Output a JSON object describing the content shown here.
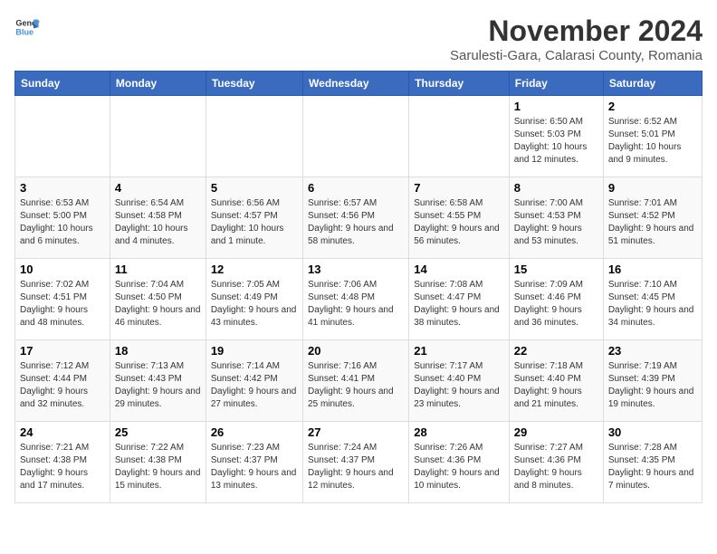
{
  "header": {
    "logo_line1": "General",
    "logo_line2": "Blue",
    "title": "November 2024",
    "subtitle": "Sarulesti-Gara, Calarasi County, Romania"
  },
  "calendar": {
    "days_of_week": [
      "Sunday",
      "Monday",
      "Tuesday",
      "Wednesday",
      "Thursday",
      "Friday",
      "Saturday"
    ],
    "weeks": [
      [
        {
          "day": "",
          "info": ""
        },
        {
          "day": "",
          "info": ""
        },
        {
          "day": "",
          "info": ""
        },
        {
          "day": "",
          "info": ""
        },
        {
          "day": "",
          "info": ""
        },
        {
          "day": "1",
          "info": "Sunrise: 6:50 AM\nSunset: 5:03 PM\nDaylight: 10 hours and 12 minutes."
        },
        {
          "day": "2",
          "info": "Sunrise: 6:52 AM\nSunset: 5:01 PM\nDaylight: 10 hours and 9 minutes."
        }
      ],
      [
        {
          "day": "3",
          "info": "Sunrise: 6:53 AM\nSunset: 5:00 PM\nDaylight: 10 hours and 6 minutes."
        },
        {
          "day": "4",
          "info": "Sunrise: 6:54 AM\nSunset: 4:58 PM\nDaylight: 10 hours and 4 minutes."
        },
        {
          "day": "5",
          "info": "Sunrise: 6:56 AM\nSunset: 4:57 PM\nDaylight: 10 hours and 1 minute."
        },
        {
          "day": "6",
          "info": "Sunrise: 6:57 AM\nSunset: 4:56 PM\nDaylight: 9 hours and 58 minutes."
        },
        {
          "day": "7",
          "info": "Sunrise: 6:58 AM\nSunset: 4:55 PM\nDaylight: 9 hours and 56 minutes."
        },
        {
          "day": "8",
          "info": "Sunrise: 7:00 AM\nSunset: 4:53 PM\nDaylight: 9 hours and 53 minutes."
        },
        {
          "day": "9",
          "info": "Sunrise: 7:01 AM\nSunset: 4:52 PM\nDaylight: 9 hours and 51 minutes."
        }
      ],
      [
        {
          "day": "10",
          "info": "Sunrise: 7:02 AM\nSunset: 4:51 PM\nDaylight: 9 hours and 48 minutes."
        },
        {
          "day": "11",
          "info": "Sunrise: 7:04 AM\nSunset: 4:50 PM\nDaylight: 9 hours and 46 minutes."
        },
        {
          "day": "12",
          "info": "Sunrise: 7:05 AM\nSunset: 4:49 PM\nDaylight: 9 hours and 43 minutes."
        },
        {
          "day": "13",
          "info": "Sunrise: 7:06 AM\nSunset: 4:48 PM\nDaylight: 9 hours and 41 minutes."
        },
        {
          "day": "14",
          "info": "Sunrise: 7:08 AM\nSunset: 4:47 PM\nDaylight: 9 hours and 38 minutes."
        },
        {
          "day": "15",
          "info": "Sunrise: 7:09 AM\nSunset: 4:46 PM\nDaylight: 9 hours and 36 minutes."
        },
        {
          "day": "16",
          "info": "Sunrise: 7:10 AM\nSunset: 4:45 PM\nDaylight: 9 hours and 34 minutes."
        }
      ],
      [
        {
          "day": "17",
          "info": "Sunrise: 7:12 AM\nSunset: 4:44 PM\nDaylight: 9 hours and 32 minutes."
        },
        {
          "day": "18",
          "info": "Sunrise: 7:13 AM\nSunset: 4:43 PM\nDaylight: 9 hours and 29 minutes."
        },
        {
          "day": "19",
          "info": "Sunrise: 7:14 AM\nSunset: 4:42 PM\nDaylight: 9 hours and 27 minutes."
        },
        {
          "day": "20",
          "info": "Sunrise: 7:16 AM\nSunset: 4:41 PM\nDaylight: 9 hours and 25 minutes."
        },
        {
          "day": "21",
          "info": "Sunrise: 7:17 AM\nSunset: 4:40 PM\nDaylight: 9 hours and 23 minutes."
        },
        {
          "day": "22",
          "info": "Sunrise: 7:18 AM\nSunset: 4:40 PM\nDaylight: 9 hours and 21 minutes."
        },
        {
          "day": "23",
          "info": "Sunrise: 7:19 AM\nSunset: 4:39 PM\nDaylight: 9 hours and 19 minutes."
        }
      ],
      [
        {
          "day": "24",
          "info": "Sunrise: 7:21 AM\nSunset: 4:38 PM\nDaylight: 9 hours and 17 minutes."
        },
        {
          "day": "25",
          "info": "Sunrise: 7:22 AM\nSunset: 4:38 PM\nDaylight: 9 hours and 15 minutes."
        },
        {
          "day": "26",
          "info": "Sunrise: 7:23 AM\nSunset: 4:37 PM\nDaylight: 9 hours and 13 minutes."
        },
        {
          "day": "27",
          "info": "Sunrise: 7:24 AM\nSunset: 4:37 PM\nDaylight: 9 hours and 12 minutes."
        },
        {
          "day": "28",
          "info": "Sunrise: 7:26 AM\nSunset: 4:36 PM\nDaylight: 9 hours and 10 minutes."
        },
        {
          "day": "29",
          "info": "Sunrise: 7:27 AM\nSunset: 4:36 PM\nDaylight: 9 hours and 8 minutes."
        },
        {
          "day": "30",
          "info": "Sunrise: 7:28 AM\nSunset: 4:35 PM\nDaylight: 9 hours and 7 minutes."
        }
      ]
    ]
  }
}
